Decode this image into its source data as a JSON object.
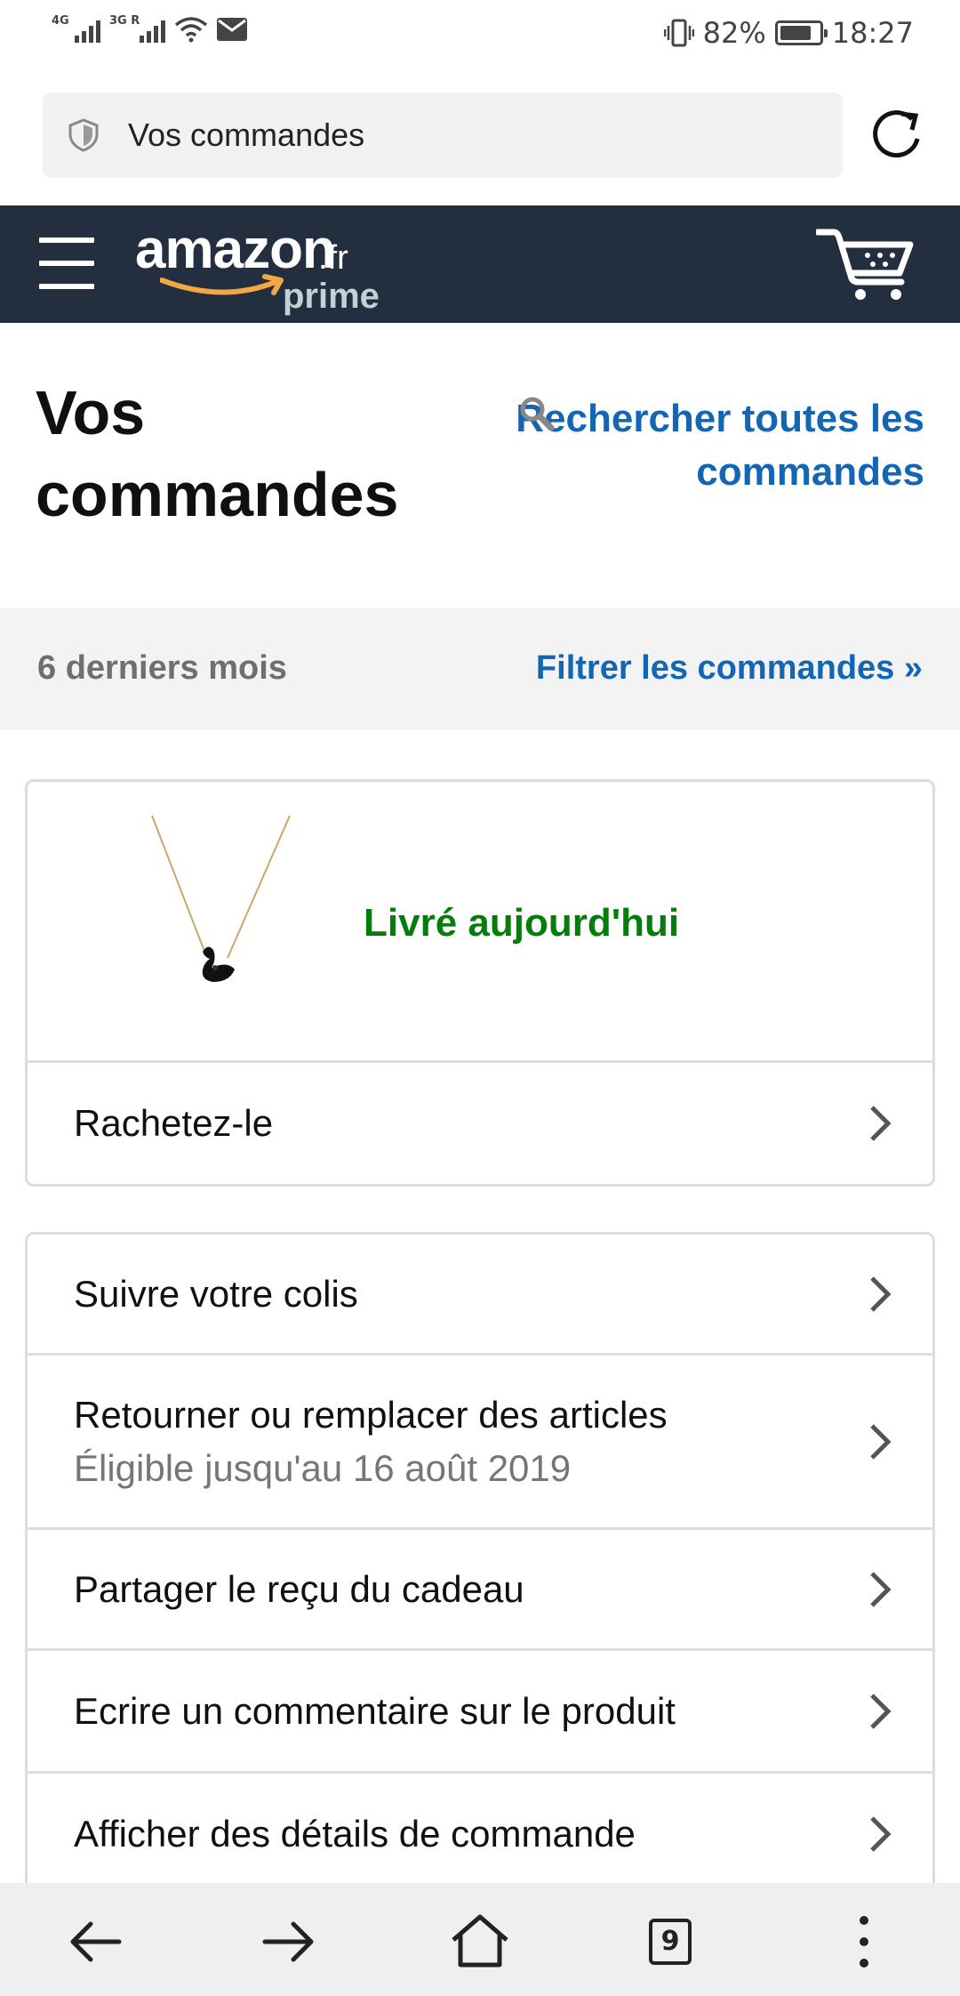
{
  "status_bar": {
    "signal1_label": "4G",
    "signal2_label": "3G R",
    "battery_percent": "82%",
    "battery_level": 0.82,
    "time": "18:27",
    "icons": [
      "signal-icon",
      "signal-icon",
      "wifi-icon",
      "mail-icon",
      "vibrate-icon",
      "battery-icon"
    ]
  },
  "browser": {
    "url_text": "Vos commandes",
    "tab_count": "9"
  },
  "header": {
    "logo_word": "amazon",
    "logo_tld": ".fr",
    "logo_prime": "prime",
    "colors": {
      "bar": "#232f3e",
      "smile": "#f3a847"
    }
  },
  "page": {
    "title": "Vos commandes",
    "search_all": "Rechercher toutes les commandes"
  },
  "filter": {
    "period": "6 derniers mois",
    "filter_link": "Filtrer les commandes »"
  },
  "order": {
    "status": "Livré aujourd'hui",
    "status_color": "#067d0b",
    "buy_again": "Rachetez-le"
  },
  "actions": [
    {
      "label": "Suivre votre colis"
    },
    {
      "label": "Retourner ou remplacer des articles",
      "sub": "Éligible jusqu'au 16 août 2019"
    },
    {
      "label": "Partager le reçu du cadeau"
    },
    {
      "label": "Ecrire un commentaire sur le produit"
    },
    {
      "label": "Afficher des détails de commande"
    }
  ]
}
